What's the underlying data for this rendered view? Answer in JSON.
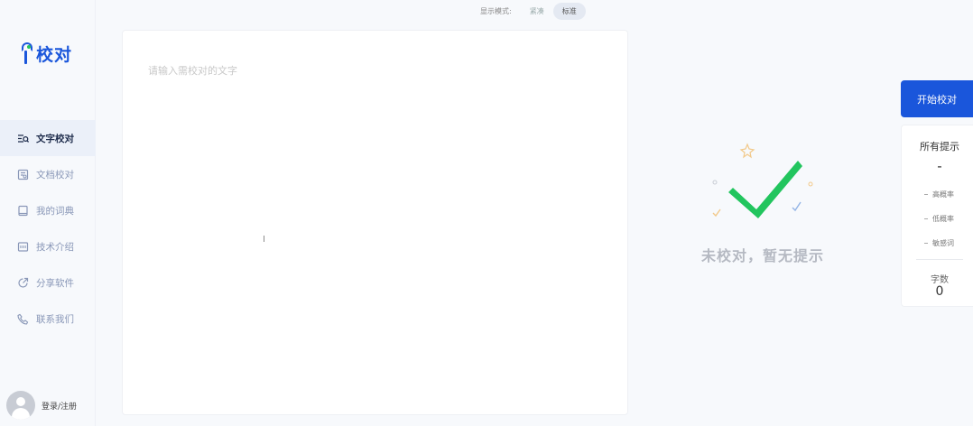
{
  "app": {
    "logo_text": "校对"
  },
  "mode_bar": {
    "label": "显示模式:",
    "options": [
      "紧凑",
      "标准"
    ],
    "selected": "标准"
  },
  "sidebar": {
    "items": [
      {
        "label": "文字校对",
        "icon": "text-search-icon",
        "active": true
      },
      {
        "label": "文档校对",
        "icon": "document-icon",
        "active": false
      },
      {
        "label": "我的词典",
        "icon": "book-icon",
        "active": false
      },
      {
        "label": "技术介绍",
        "icon": "tech-icon",
        "active": false
      },
      {
        "label": "分享软件",
        "icon": "share-icon",
        "active": false
      },
      {
        "label": "联系我们",
        "icon": "phone-icon",
        "active": false
      }
    ],
    "user_label": "登录/注册"
  },
  "editor": {
    "placeholder": "请输入需校对的文字",
    "value": ""
  },
  "empty_state": {
    "text": "未校对，暂无提示"
  },
  "panel": {
    "start_button": "开始校对",
    "title": "所有提示",
    "dash": "-",
    "rows": [
      "高概率",
      "低概率",
      "敏感词"
    ],
    "count_label": "字数",
    "count_value": "0"
  },
  "colors": {
    "primary": "#1a56db",
    "check_green": "#22c55e",
    "background": "#f7f9fc"
  }
}
